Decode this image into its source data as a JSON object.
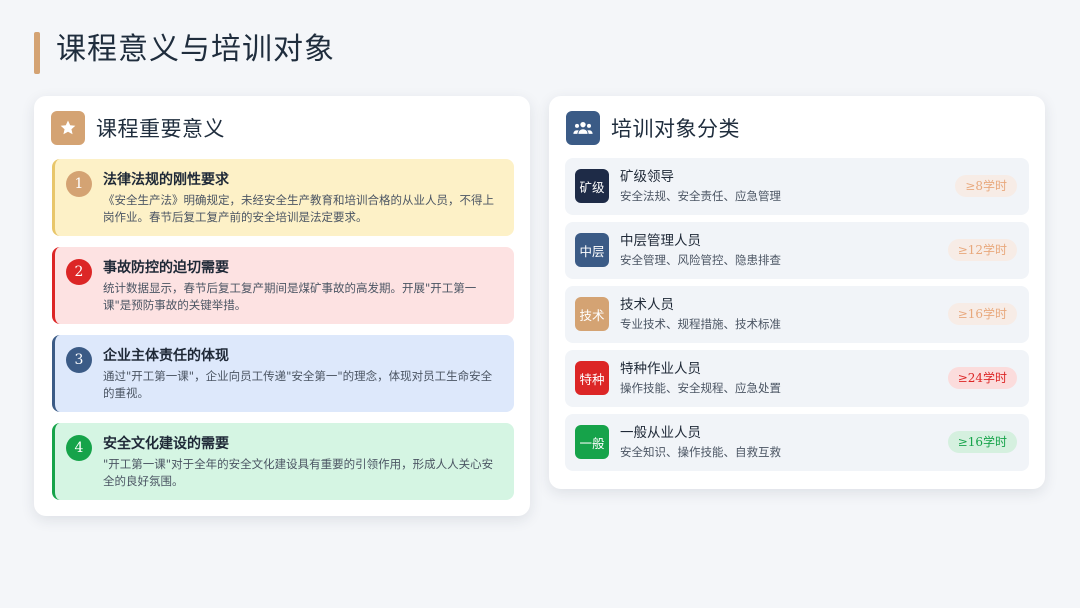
{
  "page": {
    "title": "课程意义与培训对象"
  },
  "significance": {
    "title": "课程重要意义",
    "icon": "star-icon",
    "accent": "#d4a373",
    "items": [
      {
        "num": "1",
        "title": "法律法规的刚性要求",
        "desc": "《安全生产法》明确规定，未经安全生产教育和培训合格的从业人员，不得上岗作业。春节后复工复产前的安全培训是法定要求。",
        "bg": "#fdf1c7",
        "border": "#e8c66a",
        "numColor": "#d4a373"
      },
      {
        "num": "2",
        "title": "事故防控的迫切需要",
        "desc": "统计数据显示，春节后复工复产期间是煤矿事故的高发期。开展\"开工第一课\"是预防事故的关键举措。",
        "bg": "#fde2e2",
        "border": "#dc2626",
        "numColor": "#dc2626"
      },
      {
        "num": "3",
        "title": "企业主体责任的体现",
        "desc": "通过\"开工第一课\"，企业向员工传递\"安全第一\"的理念，体现对员工生命安全的重视。",
        "bg": "#dde8fb",
        "border": "#3b5b86",
        "numColor": "#3b5b86"
      },
      {
        "num": "4",
        "title": "安全文化建设的需要",
        "desc": "\"开工第一课\"对于全年的安全文化建设具有重要的引领作用，形成人人关心安全的良好氛围。",
        "bg": "#d5f5e3",
        "border": "#16a34a",
        "numColor": "#16a34a"
      }
    ]
  },
  "audience": {
    "title": "培训对象分类",
    "icon": "users-icon",
    "accent": "#3b5b86",
    "items": [
      {
        "badge": "矿级",
        "name": "矿级领导",
        "desc": "安全法规、安全责任、应急管理",
        "hours": "≥8学时",
        "badgeColor": "#1e2b47",
        "hoursColor": "#e8a87c",
        "hoursBg": "#f7ece6"
      },
      {
        "badge": "中层",
        "name": "中层管理人员",
        "desc": "安全管理、风险管控、隐患排查",
        "hours": "≥12学时",
        "badgeColor": "#3b5b86",
        "hoursColor": "#e8a87c",
        "hoursBg": "#f7ece6"
      },
      {
        "badge": "技术",
        "name": "技术人员",
        "desc": "专业技术、规程措施、技术标准",
        "hours": "≥16学时",
        "badgeColor": "#d4a373",
        "hoursColor": "#e8a87c",
        "hoursBg": "#f7ece6"
      },
      {
        "badge": "特种",
        "name": "特种作业人员",
        "desc": "操作技能、安全规程、应急处置",
        "hours": "≥24学时",
        "badgeColor": "#dc2626",
        "hoursColor": "#dc2626",
        "hoursBg": "#fbdcdc"
      },
      {
        "badge": "一般",
        "name": "一般从业人员",
        "desc": "安全知识、操作技能、自救互救",
        "hours": "≥16学时",
        "badgeColor": "#16a34a",
        "hoursColor": "#16a34a",
        "hoursBg": "#d5f0df"
      }
    ]
  }
}
